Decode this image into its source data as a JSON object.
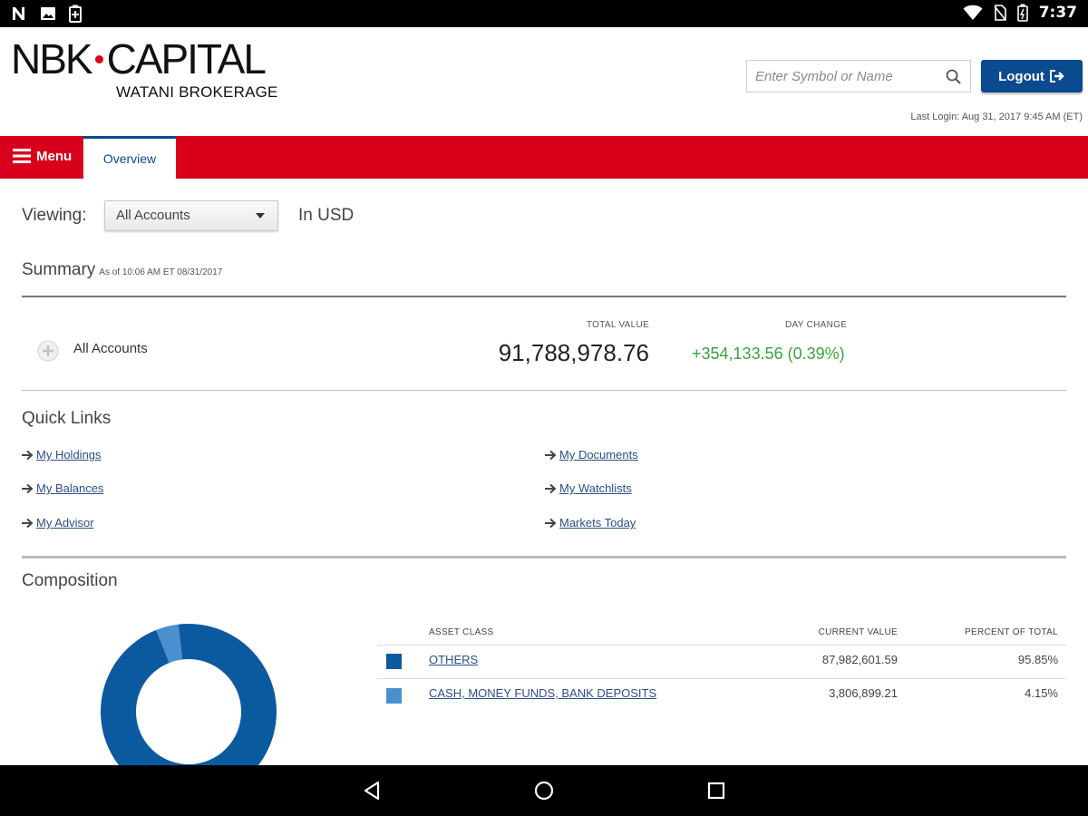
{
  "status_bar": {
    "time": "7:37",
    "left_icons": [
      "notification-n-icon",
      "image-icon",
      "battery-saver-icon"
    ],
    "right_icons": [
      "wifi-icon",
      "no-sim-icon",
      "battery-icon"
    ]
  },
  "header": {
    "logo": {
      "brand_left": "NBK",
      "brand_right": "CAPITAL",
      "sub": "WATANI BROKERAGE"
    },
    "search": {
      "placeholder": "Enter Symbol or Name"
    },
    "logout_label": "Logout",
    "last_login": "Last Login: Aug 31, 2017 9:45 AM (ET)"
  },
  "nav": {
    "menu_label": "Menu",
    "tab_overview": "Overview"
  },
  "viewing": {
    "label": "Viewing:",
    "selected": "All Accounts",
    "currency": "In USD"
  },
  "summary": {
    "title": "Summary",
    "as_of": "As of 10:06 AM ET 08/31/2017",
    "account_name": "All Accounts",
    "total_value_label": "TOTAL VALUE",
    "total_value": "91,788,978.76",
    "day_change_label": "DAY CHANGE",
    "day_change": "+354,133.56 (0.39%)"
  },
  "quick_links": {
    "title": "Quick Links",
    "items": [
      {
        "label": "My Holdings"
      },
      {
        "label": "My Balances"
      },
      {
        "label": "My Advisor"
      },
      {
        "label": "My Documents"
      },
      {
        "label": "My Watchlists"
      },
      {
        "label": "Markets Today"
      }
    ]
  },
  "composition": {
    "title": "Composition",
    "headers": {
      "asset_class": "ASSET CLASS",
      "current_value": "CURRENT VALUE",
      "percent": "PERCENT OF TOTAL"
    },
    "rows": [
      {
        "asset": "OTHERS",
        "value": "87,982,601.59",
        "percent": "95.85%",
        "color": "#0b5aa0",
        "fraction": 0.9585
      },
      {
        "asset": "CASH, MONEY FUNDS, BANK DEPOSITS",
        "value": "3,806,899.21",
        "percent": "4.15%",
        "color": "#4a90cf",
        "fraction": 0.0415
      }
    ]
  },
  "colors": {
    "brand_red": "#d9001b",
    "brand_blue": "#0b4a8f",
    "positive_green": "#3aa33a",
    "link_blue": "#2d4e8a"
  }
}
